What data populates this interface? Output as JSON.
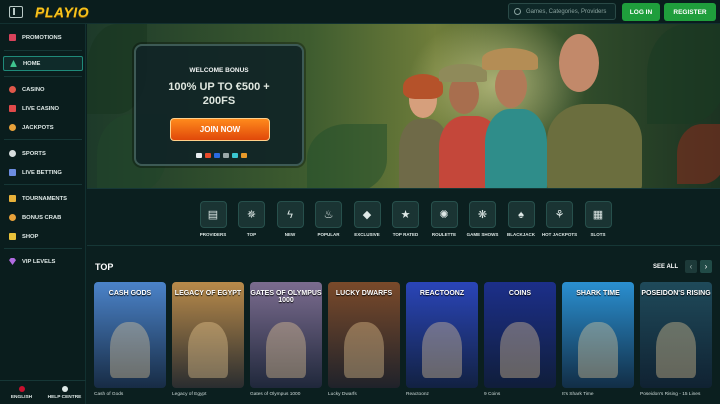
{
  "header": {
    "logo": "PLAYIO",
    "search_placeholder": "Games, Categories, Providers",
    "login_label": "LOG IN",
    "register_label": "REGISTER"
  },
  "sidebar": {
    "items": [
      {
        "label": "PROMOTIONS",
        "icon": "gift-icon"
      },
      {
        "label": "HOME",
        "icon": "home-icon"
      },
      {
        "label": "CASINO",
        "icon": "casino-chip-icon"
      },
      {
        "label": "LIVE CASINO",
        "icon": "live-casino-icon"
      },
      {
        "label": "JACKPOTS",
        "icon": "jackpot-icon"
      },
      {
        "label": "SPORTS",
        "icon": "football-icon"
      },
      {
        "label": "LIVE BETTING",
        "icon": "live-betting-icon"
      },
      {
        "label": "TOURNAMENTS",
        "icon": "trophy-icon"
      },
      {
        "label": "BONUS CRAB",
        "icon": "crab-icon"
      },
      {
        "label": "SHOP",
        "icon": "shop-icon"
      },
      {
        "label": "VIP LEVELS",
        "icon": "diamond-icon"
      }
    ],
    "language": "ENGLISH",
    "help": "HELP CENTRE"
  },
  "hero": {
    "welcome": "WELCOME BONUS",
    "offer_line1": "100% UP TO €500 +",
    "offer_line2": "200FS",
    "join_label": "JOIN NOW"
  },
  "categories": [
    {
      "label": "PROVIDERS",
      "icon": "providers-icon",
      "glyph": "▤"
    },
    {
      "label": "TOP",
      "icon": "star-burst-icon",
      "glyph": "✵"
    },
    {
      "label": "NEW",
      "icon": "lightning-icon",
      "glyph": "ϟ"
    },
    {
      "label": "POPULAR",
      "icon": "flame-icon",
      "glyph": "♨"
    },
    {
      "label": "EXCLUSIVE",
      "icon": "gem-icon",
      "glyph": "◆"
    },
    {
      "label": "TOP RATED",
      "icon": "star-icon",
      "glyph": "★"
    },
    {
      "label": "ROULETTE",
      "icon": "roulette-icon",
      "glyph": "✺"
    },
    {
      "label": "GAME SHOWS",
      "icon": "game-shows-icon",
      "glyph": "❋"
    },
    {
      "label": "BLACKJACK",
      "icon": "spade-icon",
      "glyph": "♠"
    },
    {
      "label": "HOT JACKPOTS",
      "icon": "hot-jackpot-icon",
      "glyph": "⚘"
    },
    {
      "label": "SLOTS",
      "icon": "slots-icon",
      "glyph": "▦"
    }
  ],
  "section": {
    "title": "TOP",
    "see_all": "SEE ALL"
  },
  "games": [
    {
      "name": "Cash of Gods",
      "art_title": "CASH GODS",
      "color": "#4b83c9"
    },
    {
      "name": "Legacy of Egypt",
      "art_title": "LEGACY OF EGYPT",
      "color": "#b88a4a"
    },
    {
      "name": "Gates of Olympus 1000",
      "art_title": "GATES OF OLYMPUS 1000",
      "color": "#7b6c8f"
    },
    {
      "name": "Lucky Dwarfs",
      "art_title": "LUCKY DWARFS",
      "color": "#7a4a2a"
    },
    {
      "name": "Reactoonz",
      "art_title": "REACTOONZ",
      "color": "#2a45b8"
    },
    {
      "name": "9 Coins",
      "art_title": "COINS",
      "color": "#1c2f8a"
    },
    {
      "name": "It's Shark Time",
      "art_title": "SHARK TIME",
      "color": "#2a8fd0"
    },
    {
      "name": "Poseidon's Rising - 15 Lines",
      "art_title": "POSEIDON'S RISING",
      "color": "#1f4a5a"
    }
  ]
}
